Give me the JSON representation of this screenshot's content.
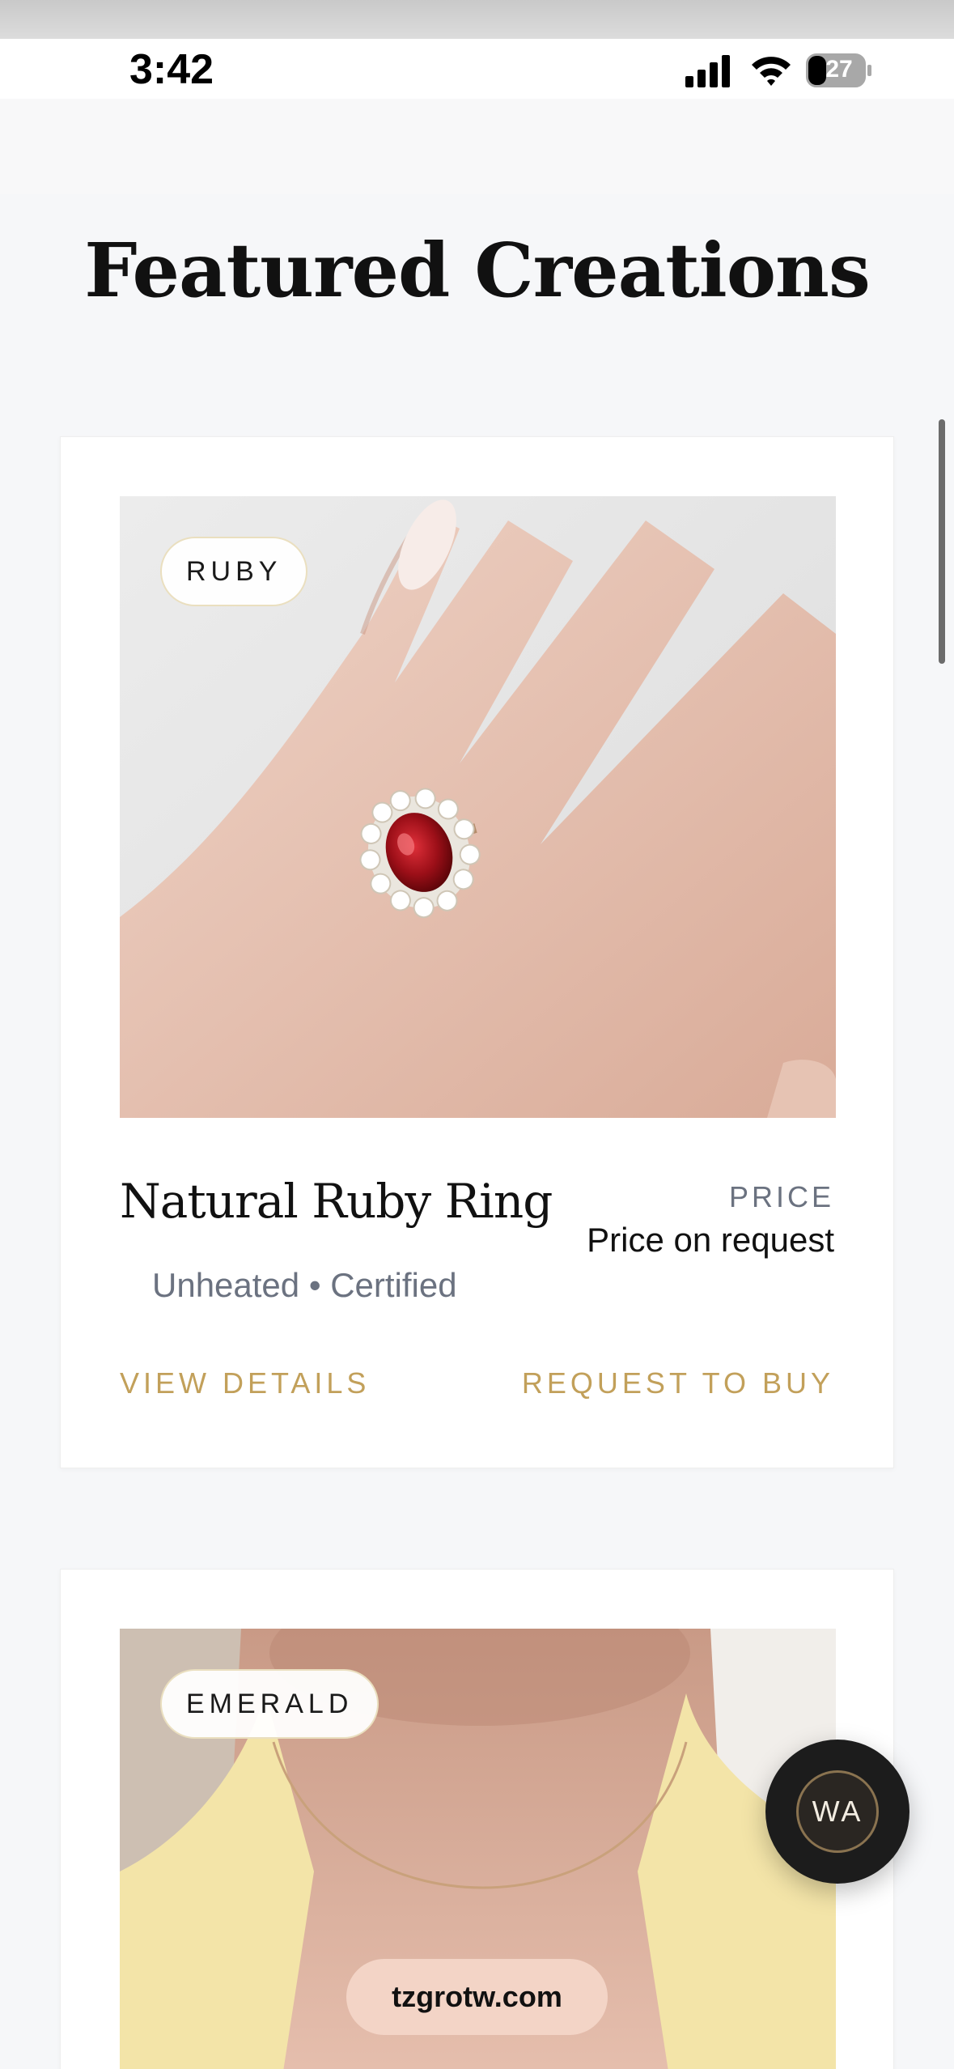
{
  "status_bar": {
    "time": "3:42",
    "battery_level": "27",
    "icons": [
      "signal-icon",
      "wifi-icon",
      "battery-icon"
    ]
  },
  "page": {
    "title": "Featured Creations"
  },
  "products": [
    {
      "tag": "RUBY",
      "name": "Natural Ruby Ring",
      "subtitle": "Unheated • Certified",
      "price_label": "PRICE",
      "price_value": "Price on request",
      "view_details_label": "VIEW DETAILS",
      "request_label": "REQUEST TO BUY"
    },
    {
      "tag": "EMERALD"
    }
  ],
  "floating_button": {
    "label": "WA"
  },
  "browser": {
    "url": "tzgrotw.com"
  },
  "colors": {
    "accent_gold": "#c2a05a",
    "muted_text": "#6b7280",
    "background": "#f6f7f9"
  }
}
